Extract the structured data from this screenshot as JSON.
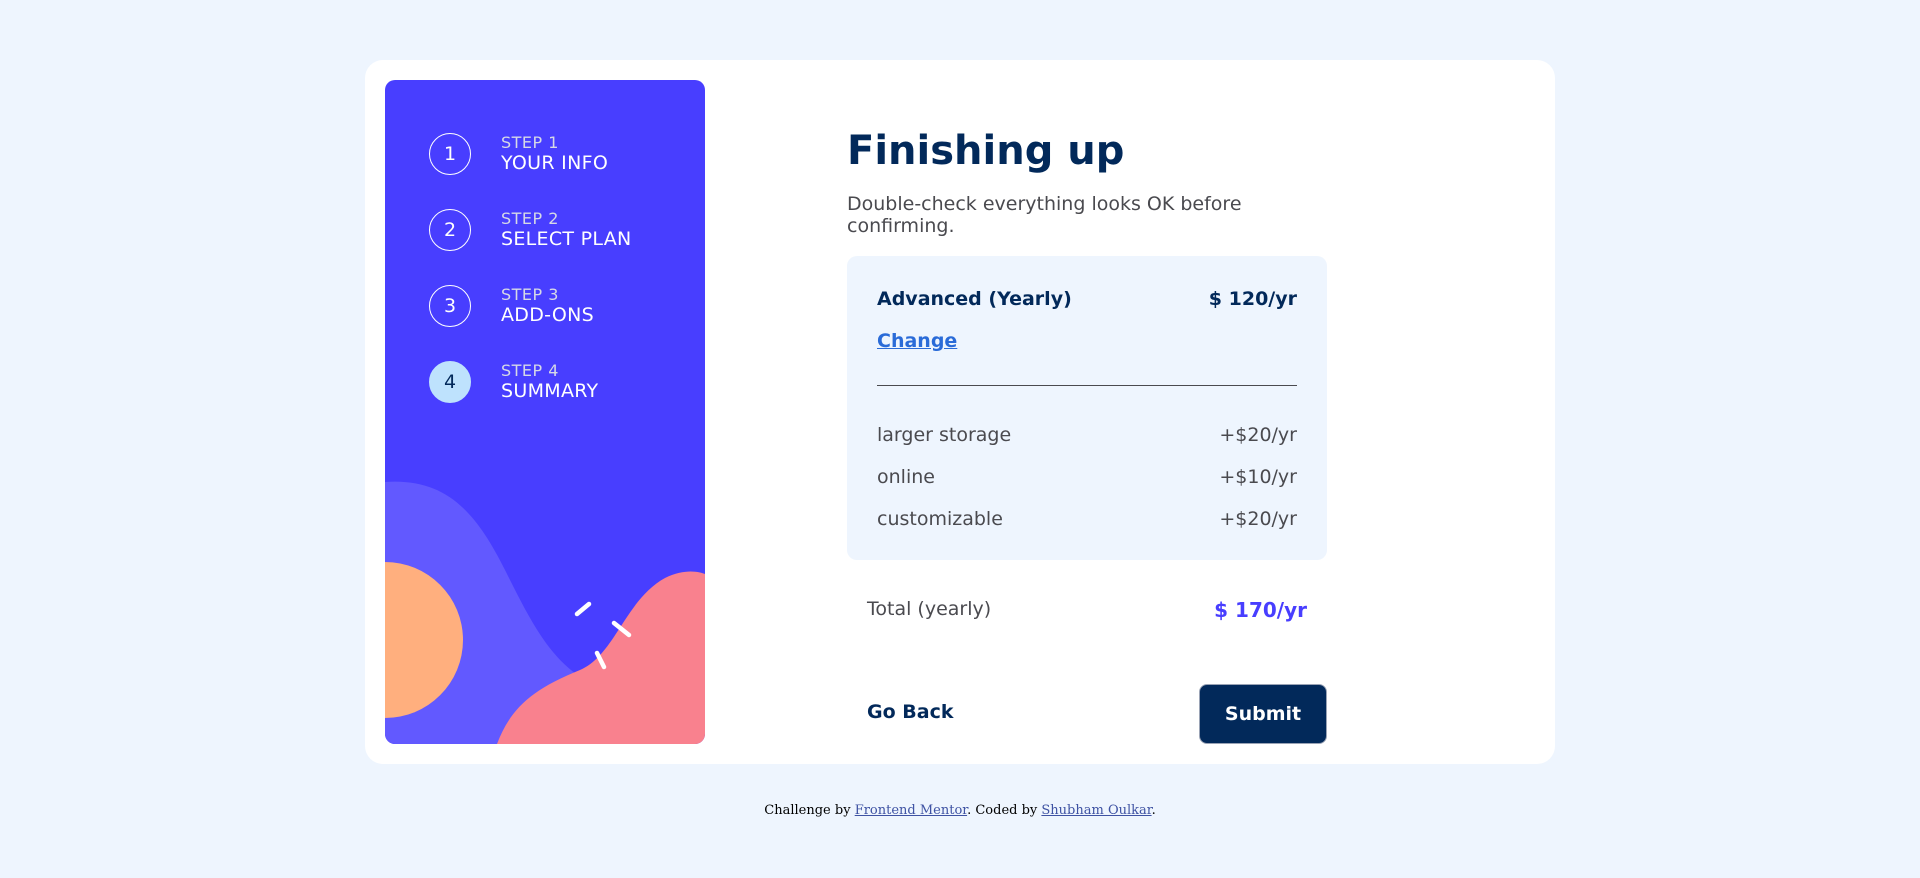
{
  "steps": [
    {
      "number": "1",
      "label": "STEP 1",
      "title": "YOUR INFO",
      "active": false
    },
    {
      "number": "2",
      "label": "STEP 2",
      "title": "SELECT PLAN",
      "active": false
    },
    {
      "number": "3",
      "label": "STEP 3",
      "title": "ADD-ONS",
      "active": false
    },
    {
      "number": "4",
      "label": "STEP 4",
      "title": "SUMMARY",
      "active": true
    }
  ],
  "main": {
    "title": "Finishing up",
    "subtitle": "Double-check everything looks OK before confirming."
  },
  "summary": {
    "plan_name": "Advanced (Yearly)",
    "plan_price": "$ 120/yr",
    "change_label": "Change",
    "addons": [
      {
        "name": "larger storage",
        "price": "+$20/yr"
      },
      {
        "name": "online",
        "price": "+$10/yr"
      },
      {
        "name": "customizable",
        "price": "+$20/yr"
      }
    ],
    "total_label": "Total (yearly)",
    "total_value": "$ 170/yr"
  },
  "buttons": {
    "back_label": "Go Back",
    "submit_label": "Submit"
  },
  "footer": {
    "prefix": "Challenge by ",
    "link1": "Frontend Mentor",
    "middle": ". Coded by ",
    "link2": "Shubham Oulkar",
    "suffix": "."
  },
  "colors": {
    "sidebar_bg": "#483eff",
    "deco_purple": "#6259ff",
    "deco_orange": "#ffaf7e",
    "deco_pink": "#f9818e",
    "accent": "#483eff",
    "marine": "#02295a",
    "page_bg": "#eef5fe"
  }
}
